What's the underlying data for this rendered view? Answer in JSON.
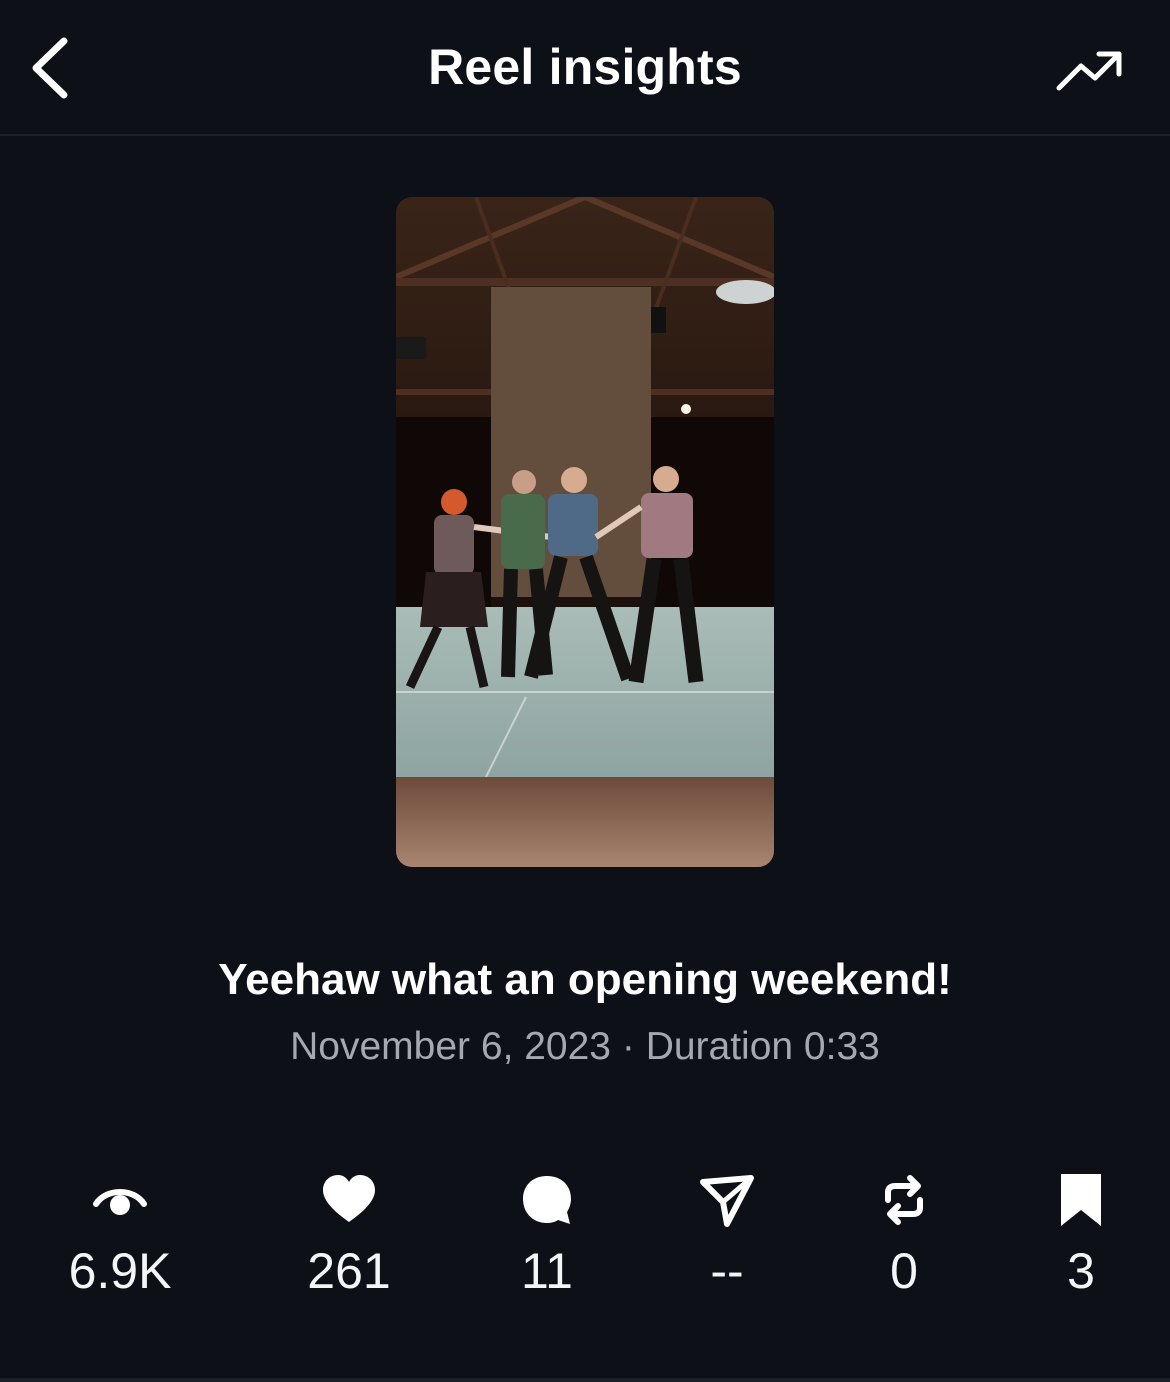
{
  "header": {
    "title": "Reel insights"
  },
  "reel": {
    "caption": "Yeehaw what an opening weekend!",
    "date": "November 6, 2023",
    "separator": "·",
    "duration_label": "Duration 0:33"
  },
  "stats": [
    {
      "icon": "eye-icon",
      "value": "6.9K"
    },
    {
      "icon": "heart-icon",
      "value": "261"
    },
    {
      "icon": "comment-icon",
      "value": "11"
    },
    {
      "icon": "share-icon",
      "value": "--"
    },
    {
      "icon": "repost-icon",
      "value": "0"
    },
    {
      "icon": "bookmark-icon",
      "value": "3"
    }
  ]
}
